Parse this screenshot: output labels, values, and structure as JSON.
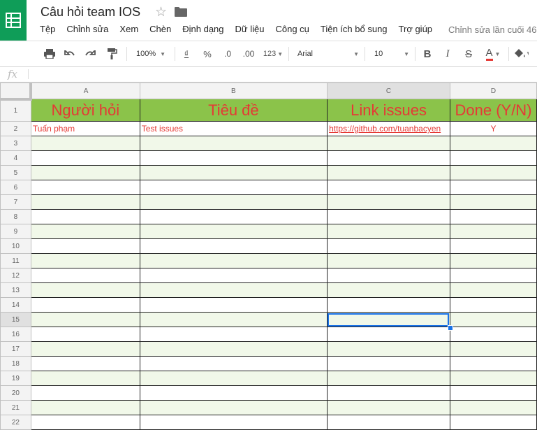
{
  "header": {
    "title": "Câu hỏi team IOS",
    "last_edit": "Chỉnh sửa lần cuối 46",
    "menu": [
      "Tệp",
      "Chỉnh sửa",
      "Xem",
      "Chèn",
      "Định dạng",
      "Dữ liệu",
      "Công cụ",
      "Tiện ích bổ sung",
      "Trợ giúp"
    ]
  },
  "toolbar": {
    "zoom": "100%",
    "currency": "₫",
    "percent": "%",
    "dec_decrease": ".0",
    "dec_increase": ".00",
    "more_formats": "123",
    "font": "Arial",
    "font_size": "10",
    "bold": "B",
    "italic": "I",
    "strike": "S",
    "text_color": "A"
  },
  "formula": {
    "fx": "fx",
    "value": ""
  },
  "columns": [
    "A",
    "B",
    "C",
    "D"
  ],
  "rows": [
    {
      "n": "1",
      "cells": [
        "Người hỏi",
        "Tiêu đề",
        "Link issues",
        "Done (Y/N)"
      ]
    },
    {
      "n": "2",
      "cells": [
        "Tuấn phạm",
        "Test issues",
        "https://github.com/tuanbacyen",
        "Y"
      ]
    },
    {
      "n": "3",
      "cells": [
        "",
        "",
        "",
        ""
      ]
    },
    {
      "n": "4",
      "cells": [
        "",
        "",
        "",
        ""
      ]
    },
    {
      "n": "5",
      "cells": [
        "",
        "",
        "",
        ""
      ]
    },
    {
      "n": "6",
      "cells": [
        "",
        "",
        "",
        ""
      ]
    },
    {
      "n": "7",
      "cells": [
        "",
        "",
        "",
        ""
      ]
    },
    {
      "n": "8",
      "cells": [
        "",
        "",
        "",
        ""
      ]
    },
    {
      "n": "9",
      "cells": [
        "",
        "",
        "",
        ""
      ]
    },
    {
      "n": "10",
      "cells": [
        "",
        "",
        "",
        ""
      ]
    },
    {
      "n": "11",
      "cells": [
        "",
        "",
        "",
        ""
      ]
    },
    {
      "n": "12",
      "cells": [
        "",
        "",
        "",
        ""
      ]
    },
    {
      "n": "13",
      "cells": [
        "",
        "",
        "",
        ""
      ]
    },
    {
      "n": "14",
      "cells": [
        "",
        "",
        "",
        ""
      ]
    },
    {
      "n": "15",
      "cells": [
        "",
        "",
        "",
        ""
      ]
    },
    {
      "n": "16",
      "cells": [
        "",
        "",
        "",
        ""
      ]
    },
    {
      "n": "17",
      "cells": [
        "",
        "",
        "",
        ""
      ]
    },
    {
      "n": "18",
      "cells": [
        "",
        "",
        "",
        ""
      ]
    },
    {
      "n": "19",
      "cells": [
        "",
        "",
        "",
        ""
      ]
    },
    {
      "n": "20",
      "cells": [
        "",
        "",
        "",
        ""
      ]
    },
    {
      "n": "21",
      "cells": [
        "",
        "",
        "",
        ""
      ]
    },
    {
      "n": "22",
      "cells": [
        "",
        "",
        "",
        ""
      ]
    }
  ],
  "selected_cell": "C15",
  "colors": {
    "header_fill": "#8bc34a",
    "band_fill": "#f1f8e9",
    "text_red": "#e53935",
    "selection": "#1a73e8"
  }
}
